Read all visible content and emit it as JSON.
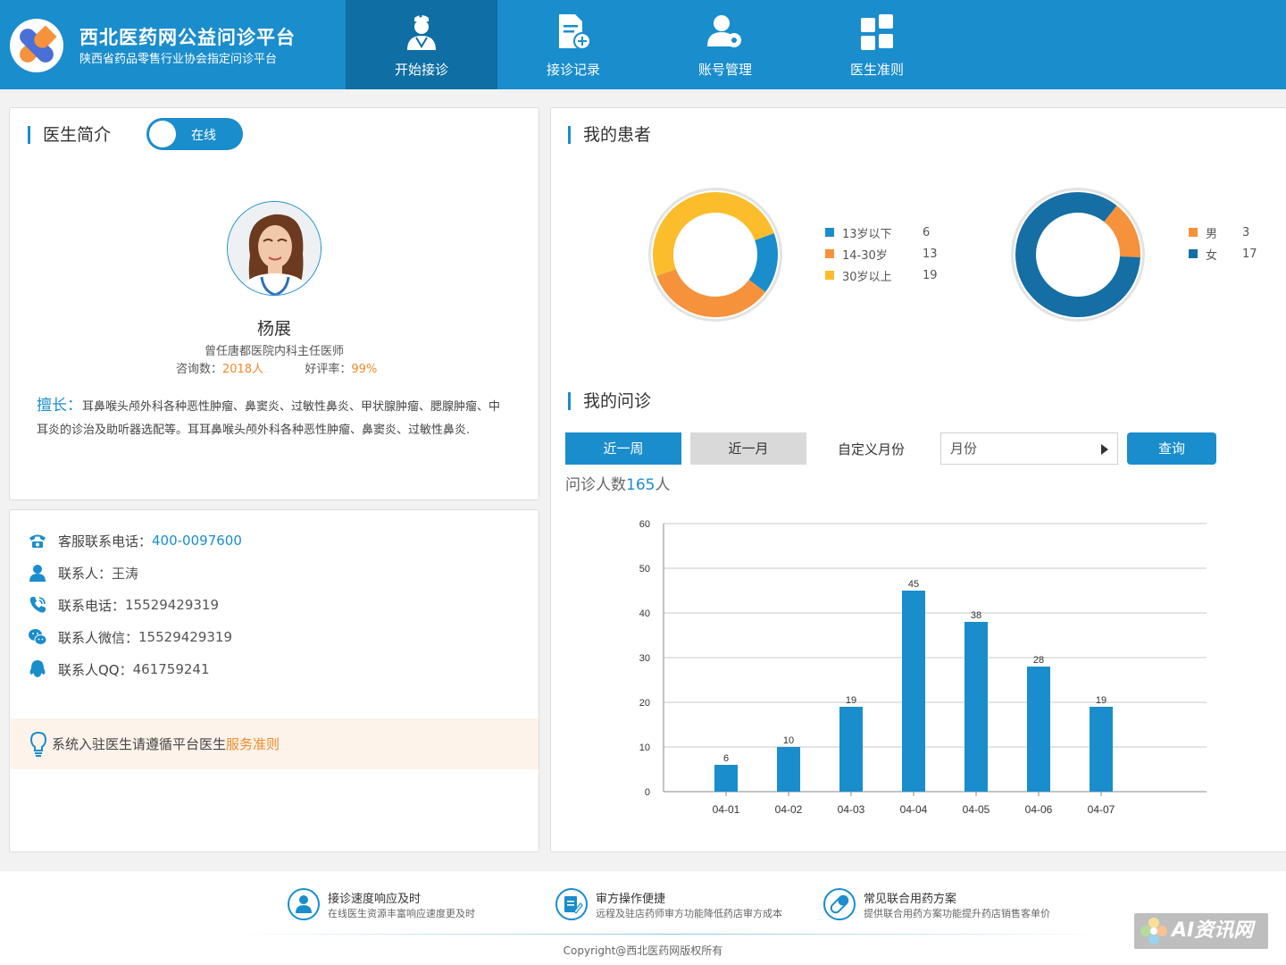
{
  "header": {
    "title": "西北医药网公益问诊平台",
    "subtitle": "陕西省药品零售行业协会指定问诊平台",
    "nav": [
      {
        "label": "开始接诊",
        "icon": "doctor-icon",
        "active": true
      },
      {
        "label": "接诊记录",
        "icon": "record-add-icon",
        "active": false
      },
      {
        "label": "账号管理",
        "icon": "user-settings-icon",
        "active": false
      },
      {
        "label": "医生准则",
        "icon": "grid-icon",
        "active": false
      }
    ]
  },
  "profile": {
    "section_title": "医生简介",
    "status_toggle": "在线",
    "name": "杨展",
    "title": "曾任唐都医院内科主任医师",
    "consult_label": "咨询数：",
    "consult_value": "2018人",
    "rating_label": "好评率：",
    "rating_value": "99%",
    "specialty_label": "擅长：",
    "specialty_text": "耳鼻喉头颅外科各种恶性肿瘤、鼻窦炎、过敏性鼻炎、甲状腺肿瘤、腮腺肿瘤、中耳炎的诊治及助听器选配等。耳耳鼻喉头颅外科各种恶性肿瘤、鼻窦炎、过敏性鼻炎."
  },
  "contact": {
    "hotline_label": "客服联系电话：",
    "hotline_value": "400-0097600",
    "person_label": "联系人：",
    "person_value": "王涛",
    "phone_label": "联系电话：",
    "phone_value": "15529429319",
    "wechat_label": "联系人微信：",
    "wechat_value": "15529429319",
    "qq_label": "联系人QQ：",
    "qq_value": "461759241",
    "notice_text": "系统入驻医生请遵循平台医生",
    "notice_link": "服务准则"
  },
  "patients": {
    "section_title": "我的患者",
    "age": [
      {
        "label": "13岁以下",
        "value": 6,
        "color": "#1a8dcc"
      },
      {
        "label": "14-30岁",
        "value": 13,
        "color": "#f5923b"
      },
      {
        "label": "30岁以上",
        "value": 19,
        "color": "#fbbd2b"
      }
    ],
    "gender": [
      {
        "label": "男",
        "value": 3,
        "color": "#f5923b"
      },
      {
        "label": "女",
        "value": 17,
        "color": "#156ea4"
      }
    ]
  },
  "consult": {
    "section_title": "我的问诊",
    "btn_week": "近一周",
    "btn_month": "近一月",
    "custom_label": "自定义月份",
    "select_placeholder": "月份",
    "query_button": "查询",
    "count_prefix": "问诊人数",
    "count_value": "165",
    "count_unit": "人"
  },
  "chart_data": {
    "type": "bar",
    "categories": [
      "04-01",
      "04-02",
      "04-03",
      "04-04",
      "04-05",
      "04-06",
      "04-07"
    ],
    "values": [
      6,
      10,
      19,
      45,
      38,
      28,
      19
    ],
    "ylim": [
      0,
      60
    ],
    "yticks": [
      0,
      10,
      20,
      30,
      40,
      50,
      60
    ],
    "grid": true,
    "color": "#1a8dcc"
  },
  "footer": {
    "features": [
      {
        "title": "接诊速度响应及时",
        "desc": "在线医生资源丰富响应速度更及时",
        "icon": "doctor-badge-icon"
      },
      {
        "title": "审方操作便捷",
        "desc": "远程及驻店药师审方功能降低药店审方成本",
        "icon": "edit-document-icon"
      },
      {
        "title": "常见联合用药方案",
        "desc": "提供联合用药方案功能提升药店销售客单价",
        "icon": "pill-icon"
      }
    ],
    "copyright": "Copyright@西北医药网版权所有",
    "watermark": "AI资讯网"
  }
}
